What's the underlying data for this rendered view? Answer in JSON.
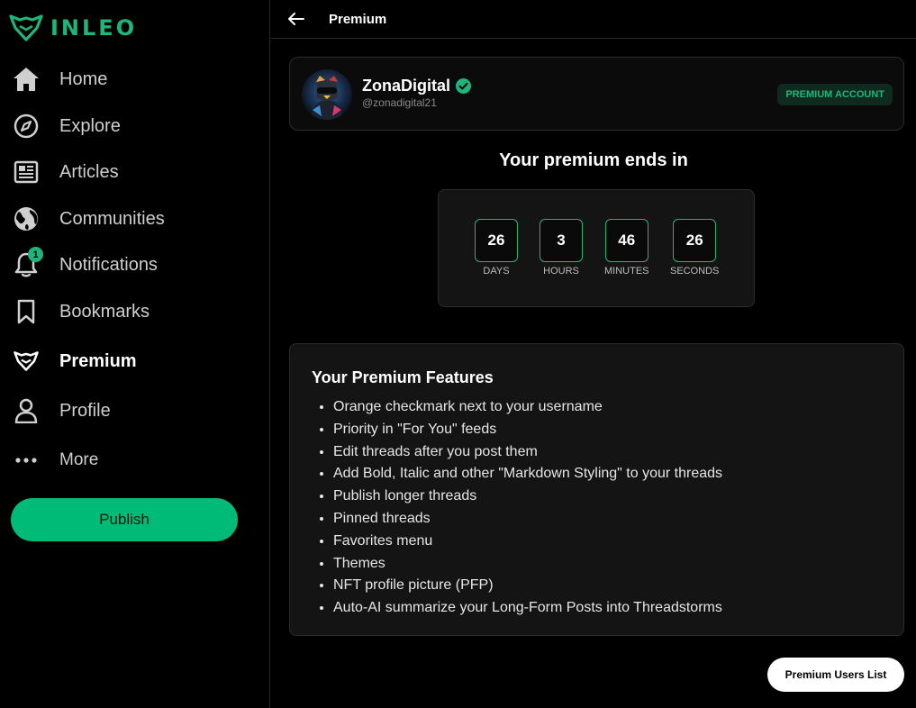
{
  "brand": {
    "name": "INLEO",
    "accent": "#1fb57a"
  },
  "sidebar": {
    "items": [
      {
        "label": "Home",
        "icon": "home-icon"
      },
      {
        "label": "Explore",
        "icon": "compass-icon"
      },
      {
        "label": "Articles",
        "icon": "newspaper-icon"
      },
      {
        "label": "Communities",
        "icon": "globe-icon"
      },
      {
        "label": "Notifications",
        "icon": "bell-icon",
        "badge": "1"
      },
      {
        "label": "Bookmarks",
        "icon": "bookmark-icon"
      },
      {
        "label": "Premium",
        "icon": "leo-icon",
        "active": true
      },
      {
        "label": "Profile",
        "icon": "user-icon"
      },
      {
        "label": "More",
        "icon": "more-icon"
      }
    ],
    "publish_label": "Publish"
  },
  "header": {
    "title": "Premium"
  },
  "profile": {
    "name": "ZonaDigital",
    "handle": "@zonadigital21",
    "badge": "PREMIUM ACCOUNT"
  },
  "countdown": {
    "title": "Your premium ends in",
    "units": [
      {
        "value": "26",
        "label": "DAYS"
      },
      {
        "value": "3",
        "label": "HOURS"
      },
      {
        "value": "46",
        "label": "MINUTES"
      },
      {
        "value": "26",
        "label": "SECONDS"
      }
    ]
  },
  "features": {
    "title": "Your Premium Features",
    "items": [
      "Orange checkmark next to your username",
      "Priority in \"For You\" feeds",
      "Edit threads after you post them",
      "Add Bold, Italic and other \"Markdown Styling\" to your threads",
      "Publish longer threads",
      "Pinned threads",
      "Favorites menu",
      "Themes",
      "NFT profile picture (PFP)",
      "Auto-AI summarize your Long-Form Posts into Threadstorms"
    ]
  },
  "footer": {
    "users_list_label": "Premium Users List"
  }
}
